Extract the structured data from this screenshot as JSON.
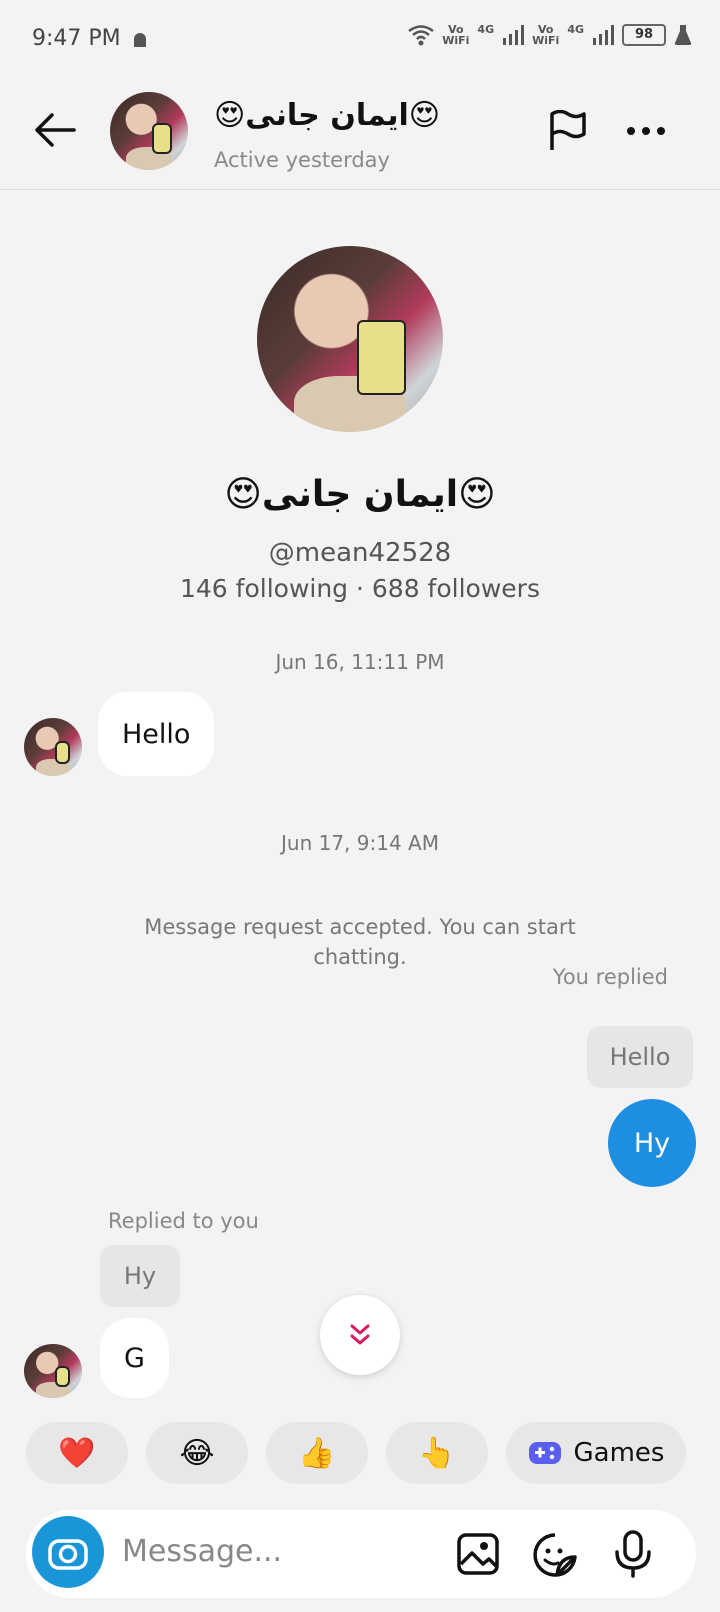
{
  "status_bar": {
    "time": "9:47 PM",
    "net1_top": "Vo",
    "net1_bottom": "WiFi",
    "lte1": "4G",
    "net2_top": "Vo",
    "net2_bottom": "WiFi",
    "lte2": "4G",
    "battery": "98"
  },
  "header": {
    "name": "😍ايمان جانی😍",
    "subtitle": "Active yesterday"
  },
  "profile": {
    "name": "😍ايمان جانی😍",
    "handle": "@mean42528",
    "stats": "146 following · 688 followers"
  },
  "conversation": {
    "ts1": "Jun 16, 11:11 PM",
    "msg_hello": "Hello",
    "ts2": "Jun 17, 9:14 AM",
    "system_msg": "Message request accepted. You can start chatting.",
    "you_replied": "You replied",
    "quoted_hello": "Hello",
    "msg_hy": "Hy",
    "replied_to_you": "Replied to you",
    "quoted_hy": "Hy",
    "msg_g": "G"
  },
  "quick_reactions": {
    "heart": "❤️",
    "laugh": "😂",
    "thumbs": "👍",
    "point": "👆",
    "games_label": "Games"
  },
  "composer": {
    "placeholder": "Message..."
  },
  "colors": {
    "accent": "#1e8fe0",
    "camera": "#1a95d8",
    "scroll_arrow": "#d81b60"
  }
}
